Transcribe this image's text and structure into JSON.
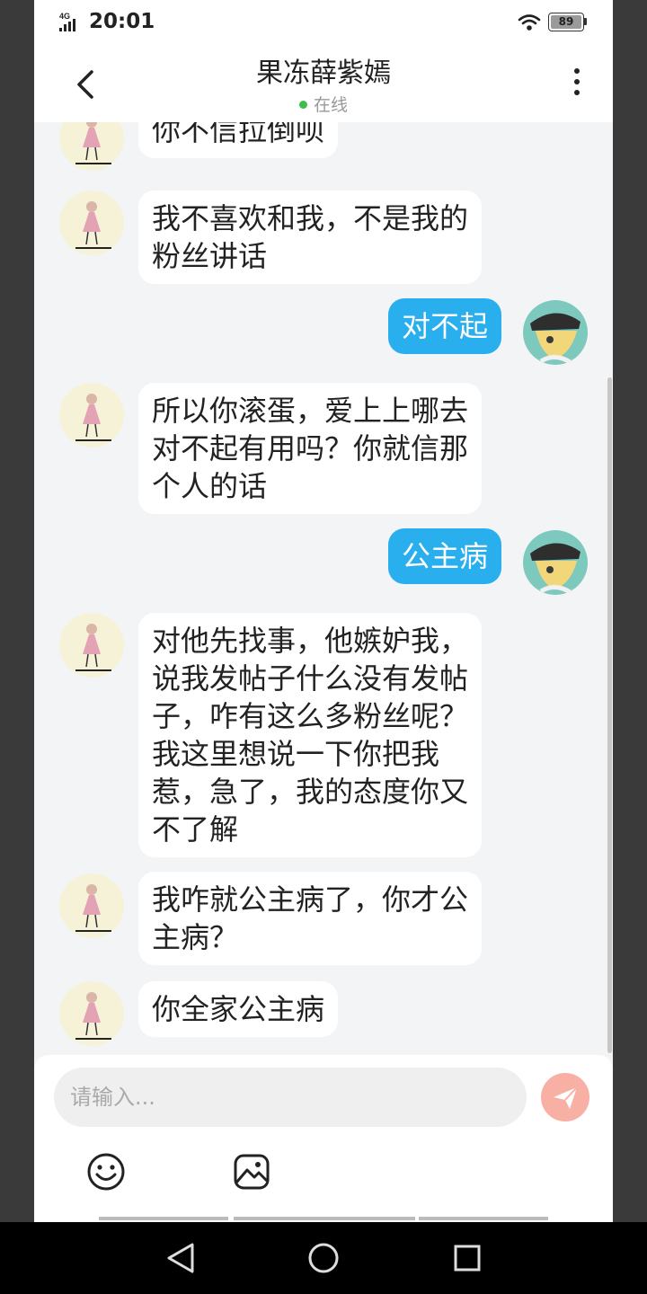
{
  "status_bar": {
    "network": "4G",
    "time": "20:01",
    "battery": "89"
  },
  "header": {
    "title": "果冻薛紫嫣",
    "status": "在线"
  },
  "messages": [
    {
      "side": "in",
      "text": "你不信拉倒呗"
    },
    {
      "side": "in",
      "text": "我不喜欢和我，不是我的\n粉丝讲话"
    },
    {
      "side": "out",
      "text": "对不起"
    },
    {
      "side": "in",
      "text": "所以你滚蛋，爱上上哪去\n对不起有用吗？你就信那\n个人的话"
    },
    {
      "side": "out",
      "text": "公主病"
    },
    {
      "side": "in",
      "text": "对他先找事，他嫉妒我，\n说我发帖子什么没有发帖\n子，咋有这么多粉丝呢？\n我这里想说一下你把我\n惹，急了，我的态度你又\n不了解"
    },
    {
      "side": "in",
      "text": "我咋就公主病了，你才公\n主病？"
    },
    {
      "side": "in",
      "text": "你全家公主病"
    }
  ],
  "composer": {
    "placeholder": "请输入..."
  },
  "colors": {
    "outgoing_bubble": "#29aeee",
    "incoming_bubble": "#ffffff",
    "send_button": "#f9b0a4",
    "online_dot": "#3fbe4c"
  },
  "icons": {
    "back": "chevron-left-icon",
    "menu": "more-vertical-icon",
    "send": "paper-plane-icon",
    "emoji": "emoji-icon",
    "image": "image-icon"
  }
}
